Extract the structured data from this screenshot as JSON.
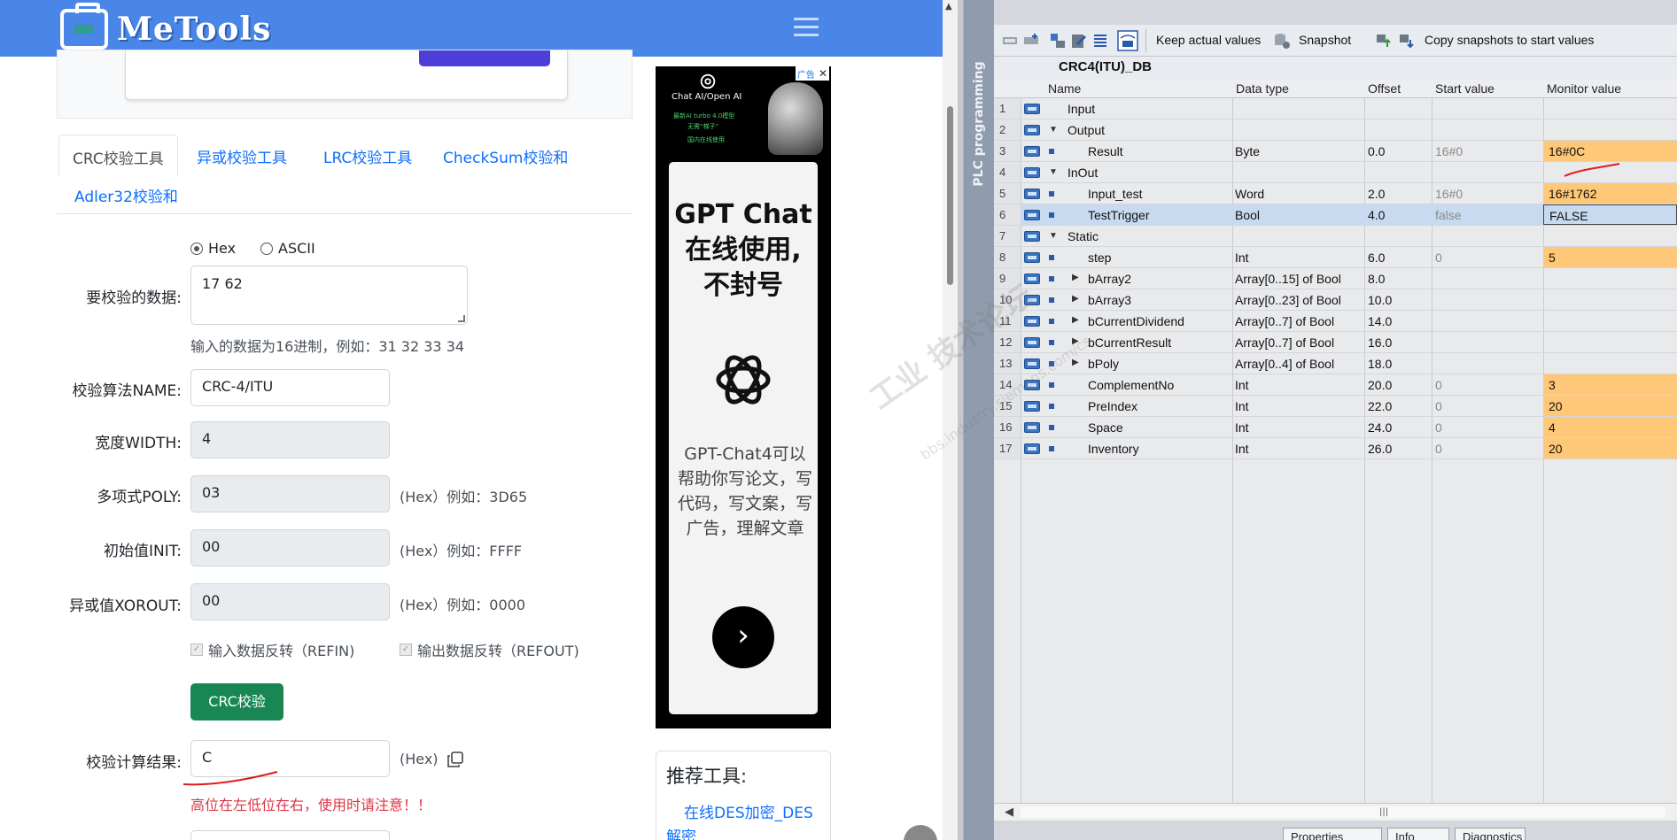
{
  "brand": {
    "name": "MeTools"
  },
  "tabs": [
    {
      "label": "CRC校验工具"
    },
    {
      "label": "异或校验工具"
    },
    {
      "label": "LRC校验工具"
    },
    {
      "label": "CheckSum校验和"
    },
    {
      "label": "Adler32校验和"
    }
  ],
  "form": {
    "format_hex": "Hex",
    "format_ascii": "ASCII",
    "data_label": "要校验的数据:",
    "data_value": "17 62",
    "data_hint": "输入的数据为16进制，例如：31 32 33 34",
    "name_label": "校验算法NAME:",
    "name_value": "CRC-4/ITU",
    "width_label": "宽度WIDTH:",
    "width_value": "4",
    "poly_label": "多项式POLY:",
    "poly_value": "03",
    "poly_hint": "(Hex）例如：3D65",
    "init_label": "初始值INIT:",
    "init_value": "00",
    "init_hint": "(Hex）例如：FFFF",
    "xorout_label": "异或值XOROUT:",
    "xorout_value": "00",
    "xorout_hint": "(Hex）例如：0000",
    "refin_label": "输入数据反转（REFIN)",
    "refout_label": "输出数据反转（REFOUT)",
    "check_button": "CRC校验",
    "result_label": "校验计算结果:",
    "result_value": "C",
    "result_hint": "(Hex)",
    "warning": "高位在左低位在右，使用时请注意！！"
  },
  "ad": {
    "badge": "广告",
    "close": "✕",
    "top_title": "Chat AI/Open AI",
    "top_line2": "最新AI turbo 4.0模型",
    "top_line3": "无需“梯子”",
    "top_line4": "国内在线使用",
    "headline": "GPT Chat 在线使用, 不封号",
    "body": "GPT-Chat4可以帮助你写论文，写代码，写文案，写广告，理解文章",
    "arrow": "›"
  },
  "recommend": {
    "title": "推荐工具:",
    "item1": "在线DES加密_DES",
    "item2": "解密"
  },
  "tia": {
    "side_label": "PLC programming",
    "toolbar": {
      "keep_actual": "Keep actual values",
      "snapshot": "Snapshot",
      "copy_snapshots": "Copy snapshots to start values"
    },
    "db_title": "CRC4(ITU)_DB",
    "columns": {
      "name": "Name",
      "type": "Data type",
      "offset": "Offset",
      "start": "Start value",
      "monitor": "Monitor value"
    },
    "rows": [
      {
        "n": "1",
        "name": "Input",
        "type": "",
        "offset": "",
        "start": "",
        "mon": ""
      },
      {
        "n": "2",
        "name": "Output",
        "type": "",
        "offset": "",
        "start": "",
        "mon": ""
      },
      {
        "n": "3",
        "name": "Result",
        "type": "Byte",
        "offset": "0.0",
        "start": "16#0",
        "mon": "16#0C"
      },
      {
        "n": "4",
        "name": "InOut",
        "type": "",
        "offset": "",
        "start": "",
        "mon": ""
      },
      {
        "n": "5",
        "name": "Input_test",
        "type": "Word",
        "offset": "2.0",
        "start": "16#0",
        "mon": "16#1762"
      },
      {
        "n": "6",
        "name": "TestTrigger",
        "type": "Bool",
        "offset": "4.0",
        "start": "false",
        "mon": "FALSE"
      },
      {
        "n": "7",
        "name": "Static",
        "type": "",
        "offset": "",
        "start": "",
        "mon": ""
      },
      {
        "n": "8",
        "name": "step",
        "type": "Int",
        "offset": "6.0",
        "start": "0",
        "mon": "5"
      },
      {
        "n": "9",
        "name": "bArray2",
        "type": "Array[0..15] of Bool",
        "offset": "8.0",
        "start": "",
        "mon": ""
      },
      {
        "n": "10",
        "name": "bArray3",
        "type": "Array[0..23] of Bool",
        "offset": "10.0",
        "start": "",
        "mon": ""
      },
      {
        "n": "11",
        "name": "bCurrentDividend",
        "type": "Array[0..7] of Bool",
        "offset": "14.0",
        "start": "",
        "mon": ""
      },
      {
        "n": "12",
        "name": "bCurrentResult",
        "type": "Array[0..7] of Bool",
        "offset": "16.0",
        "start": "",
        "mon": ""
      },
      {
        "n": "13",
        "name": "bPoly",
        "type": "Array[0..4] of Bool",
        "offset": "18.0",
        "start": "",
        "mon": ""
      },
      {
        "n": "14",
        "name": "ComplementNo",
        "type": "Int",
        "offset": "20.0",
        "start": "0",
        "mon": "3"
      },
      {
        "n": "15",
        "name": "PreIndex",
        "type": "Int",
        "offset": "22.0",
        "start": "0",
        "mon": "20"
      },
      {
        "n": "16",
        "name": "Space",
        "type": "Int",
        "offset": "24.0",
        "start": "0",
        "mon": "4"
      },
      {
        "n": "17",
        "name": "Inventory",
        "type": "Int",
        "offset": "26.0",
        "start": "0",
        "mon": "20"
      }
    ],
    "bottom_tabs": [
      "Properties",
      "Info",
      "Diagnostics"
    ]
  },
  "watermark": {
    "line1": "工业 技术论坛",
    "line2": "bbs.industry.siemens.com/cs"
  },
  "colors": {
    "topbar": "#4a86e8",
    "crc_button": "#198754",
    "highlight": "#ffc878",
    "warning": "#dc3545"
  }
}
